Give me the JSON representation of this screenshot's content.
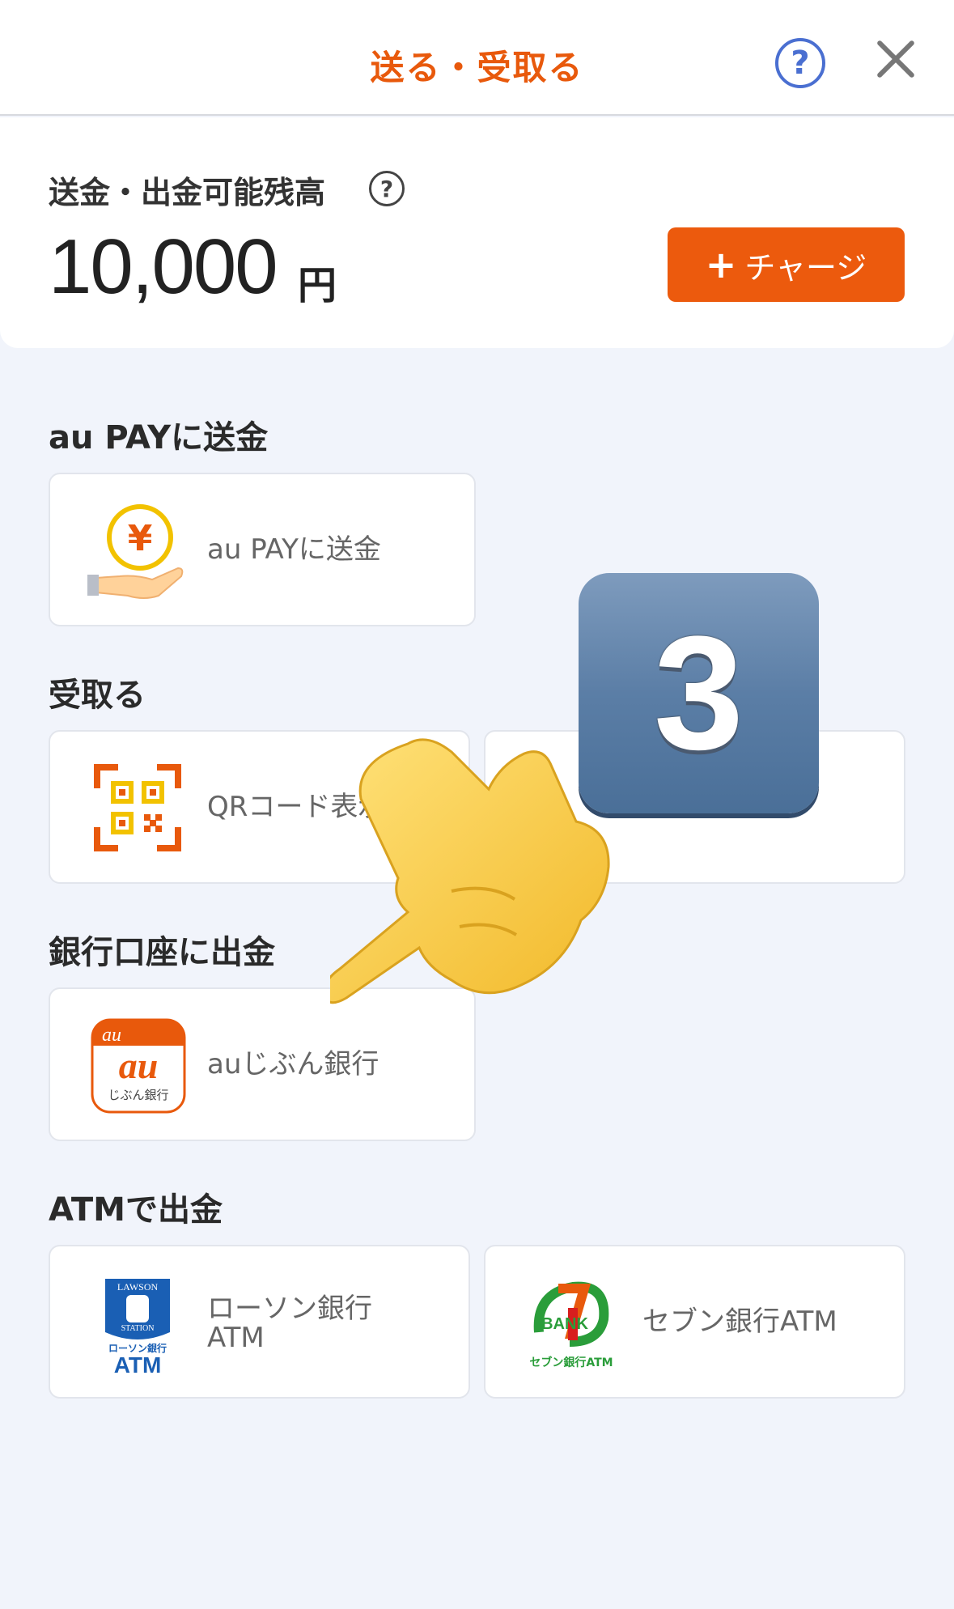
{
  "header": {
    "title": "送る・受取る",
    "help_icon": "?",
    "close_icon": "close-icon"
  },
  "balance": {
    "label": "送金・出金可能残高",
    "help_icon": "?",
    "amount": "10,000",
    "unit": "円",
    "charge_button": {
      "plus": "+",
      "label": "チャージ"
    }
  },
  "sections": {
    "send": {
      "title": "au PAYに送金",
      "item_label": "au PAYに送金",
      "coin_symbol": "¥"
    },
    "receive": {
      "title": "受取る",
      "qr_label": "QRコード表示",
      "second_label": ""
    },
    "bank": {
      "title": "銀行口座に出金",
      "item_label": "auじぶん銀行",
      "logo_top": "au",
      "logo_mid": "au",
      "logo_bottom": "じぶん銀行"
    },
    "atm": {
      "title": "ATMで出金",
      "lawson": {
        "line1": "ローソン銀行",
        "line2": "ATM",
        "logo_top": "LAWSON",
        "logo_mid": "STATION",
        "logo_small": "ローソン銀行",
        "logo_atm": "ATM"
      },
      "seven": {
        "label": "セブン銀行ATM",
        "logo_bank": "BANK",
        "logo_bottom": "セブン銀行ATM"
      }
    }
  },
  "overlay": {
    "badge_number": "3"
  },
  "colors": {
    "accent": "#ec5a0d",
    "help": "#4a6fd1",
    "background": "#f1f4fb"
  }
}
